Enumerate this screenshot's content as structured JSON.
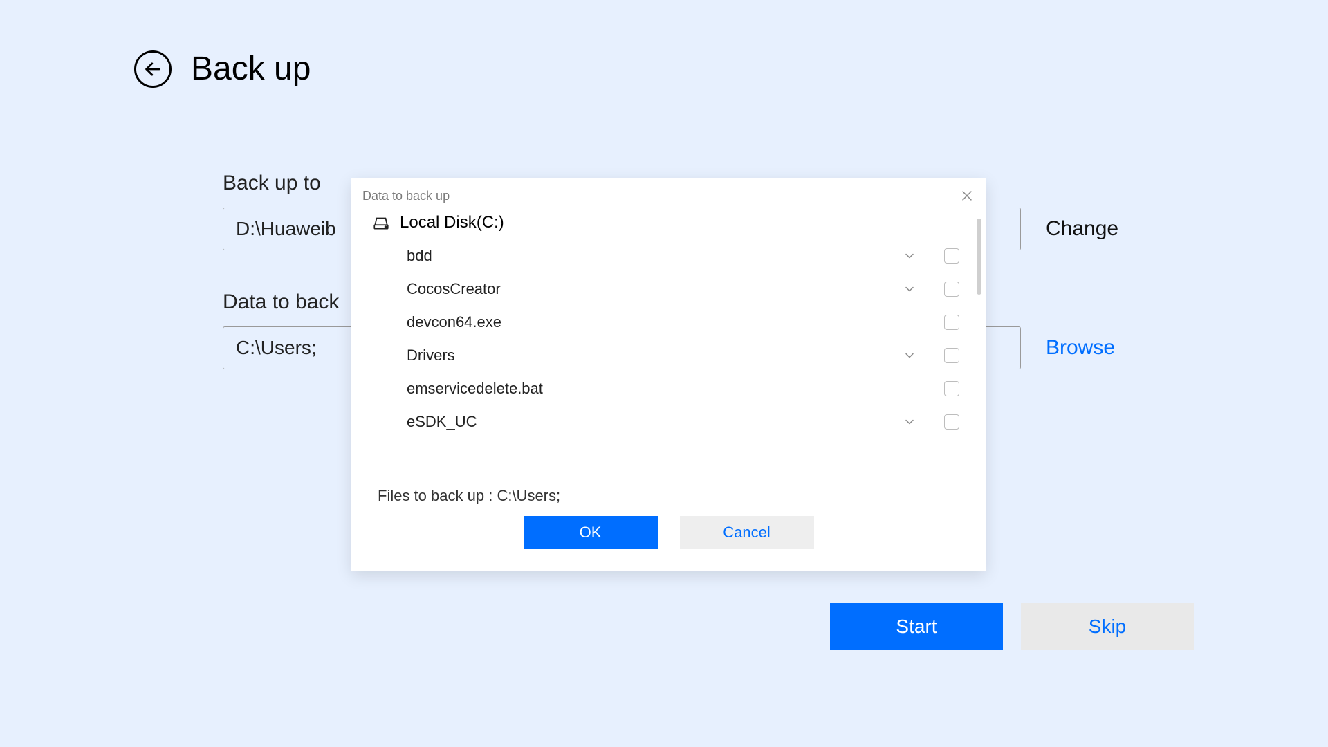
{
  "header": {
    "title": "Back up"
  },
  "form": {
    "backup_to_label": "Back up to",
    "backup_to_value": "D:\\Huaweib",
    "backup_to_action": "Change",
    "data_label": "Data to back",
    "data_value": "C:\\Users;",
    "data_action": "Browse"
  },
  "footer": {
    "start_label": "Start",
    "skip_label": "Skip"
  },
  "modal": {
    "title": "Data to back up",
    "disk_label": "Local Disk(C:)",
    "items": [
      {
        "name": "bdd",
        "expandable": true
      },
      {
        "name": "CocosCreator",
        "expandable": true
      },
      {
        "name": "devcon64.exe",
        "expandable": false
      },
      {
        "name": "Drivers",
        "expandable": true
      },
      {
        "name": "emservicedelete.bat",
        "expandable": false
      },
      {
        "name": "eSDK_UC",
        "expandable": true
      }
    ],
    "status_prefix": "Files to back up :",
    "status_value": "C:\\Users;",
    "ok_label": "OK",
    "cancel_label": "Cancel"
  },
  "colors": {
    "accent": "#006eff",
    "page_bg": "#e7f0fe"
  }
}
